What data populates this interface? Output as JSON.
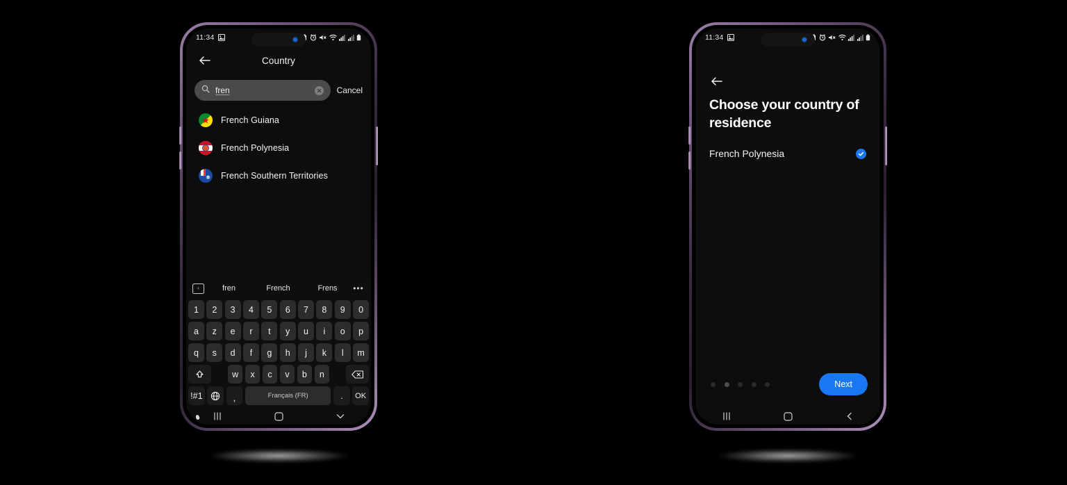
{
  "theme": {
    "accent": "#1877f2",
    "check_blue": "#1a7aed",
    "screen_bg": "#0d0d0d",
    "frame_purple": "#9b7fa8"
  },
  "left_phone": {
    "status_bar": {
      "time": "11:34",
      "left_icons": [
        "photo-icon"
      ],
      "right_icons": [
        "battery-saver-icon",
        "alarm-icon",
        "mute-icon",
        "wifi-icon",
        "signal-1-icon",
        "signal-2-icon",
        "battery-icon"
      ]
    },
    "app_bar": {
      "back_label": "back",
      "title": "Country"
    },
    "search": {
      "value": "fren",
      "placeholder": "Search",
      "cancel_label": "Cancel",
      "clear_label": "clear"
    },
    "countries": [
      {
        "name": "French Guiana",
        "flag": "gf"
      },
      {
        "name": "French Polynesia",
        "flag": "pf"
      },
      {
        "name": "French Southern Territories",
        "flag": "tf"
      }
    ],
    "keyboard": {
      "suggestions": [
        "fren",
        "French",
        "Frens"
      ],
      "more_label": "•••",
      "clipboard_label": "‹",
      "row_numbers": [
        "1",
        "2",
        "3",
        "4",
        "5",
        "6",
        "7",
        "8",
        "9",
        "0"
      ],
      "row_top": [
        "a",
        "z",
        "e",
        "r",
        "t",
        "y",
        "u",
        "i",
        "o",
        "p"
      ],
      "row_home": [
        "q",
        "s",
        "d",
        "f",
        "g",
        "h",
        "j",
        "k",
        "l",
        "m"
      ],
      "row_bottom": [
        "w",
        "x",
        "c",
        "v",
        "b",
        "n"
      ],
      "symbols_key": "!#1",
      "comma_key": ",",
      "space_key": "Français (FR)",
      "period_key": ".",
      "enter_key": "OK"
    },
    "nav_bar": {
      "recents": "|||",
      "home": "home-icon",
      "back": "chevron-down-icon"
    }
  },
  "right_phone": {
    "status_bar": {
      "time": "11:34",
      "left_icons": [
        "photo-icon"
      ],
      "right_icons": [
        "battery-saver-icon",
        "alarm-icon",
        "mute-icon",
        "wifi-icon",
        "signal-1-icon",
        "signal-2-icon",
        "battery-icon"
      ]
    },
    "back_label": "back",
    "heading": "Choose your country of residence",
    "selected_country": "French Polynesia",
    "pagination": {
      "total": 5,
      "active_index": 1
    },
    "next_label": "Next",
    "nav_bar": {
      "recents": "|||",
      "home": "home-icon",
      "back": "chevron-left-icon"
    }
  }
}
